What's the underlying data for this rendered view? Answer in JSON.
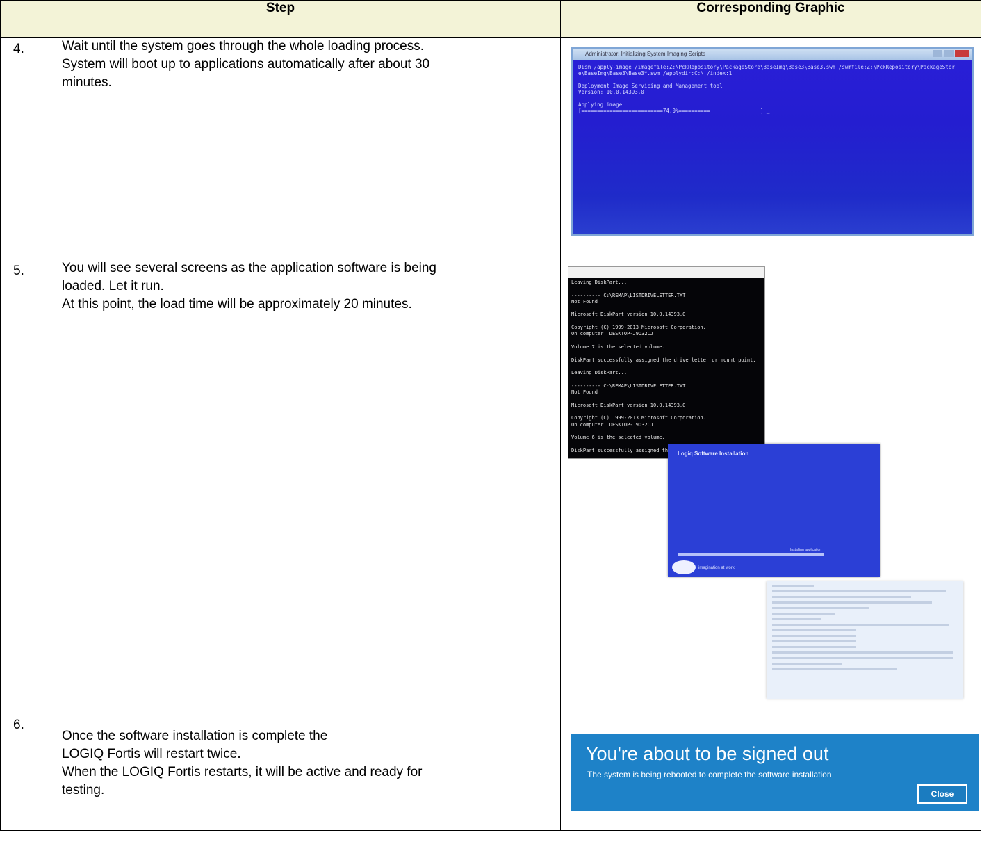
{
  "header": {
    "step": "Step",
    "graphic": "Corresponding Graphic"
  },
  "rows": [
    {
      "num": "4.",
      "lines": [
        "Wait until the system goes through the whole loading process.",
        "System will boot up to applications automatically after about 30",
        "minutes."
      ],
      "shot": {
        "title": "Administrator: Initializing System Imaging Scripts",
        "console": "Dism /apply-image /imagefile:Z:\\PckRepository\\PackageStore\\BaseImg\\Base3\\Base3.swm /swmfile:Z:\\PckRepository\\PackageStor\ne\\BaseImg\\Base3\\Base3*.swm /applydir:C:\\ /index:1\n\nDeployment Image Servicing and Management tool\nVersion: 10.0.14393.0\n\nApplying image\n[==========================74.0%==========                ] _"
      }
    },
    {
      "num": "5.",
      "lines": [
        "You will see several screens as the application software is being",
        "loaded. Let it run.",
        "At this point, the load time will be approximately 20 minutes."
      ],
      "shot": {
        "console": "Leaving DiskPart...\n\n---------- C:\\REMAP\\LISTDRIVELETTER.TXT\nNot Found\n\nMicrosoft DiskPart version 10.0.14393.0\n\nCopyright (C) 1999-2013 Microsoft Corporation.\nOn computer: DESKTOP-J9O32CJ\n\nVolume 7 is the selected volume.\n\nDiskPart successfully assigned the drive letter or mount point.\n\nLeaving DiskPart...\n\n---------- C:\\REMAP\\LISTDRIVELETTER.TXT\nNot Found\n\nMicrosoft DiskPart version 10.0.14393.0\n\nCopyright (C) 1999-2013 Microsoft Corporation.\nOn computer: DESKTOP-J9O32CJ\n\nVolume 6 is the selected volume.\n\nDiskPart successfully assigned the drive letter or mount point.\n\nLeaving DiskPart...",
        "install_title": "Logiq Software Installation",
        "progress_label": "Installing application",
        "tagline": "imagination at work"
      }
    },
    {
      "num": "6.",
      "lines": [
        "Once the software installation is complete the",
        "LOGIQ Fortis will restart twice.",
        "When the LOGIQ Fortis restarts, it will be active and ready for",
        "testing."
      ],
      "shot": {
        "heading": "You're about to be signed out",
        "message": "The system is being rebooted to complete the software installation",
        "close": "Close"
      }
    }
  ]
}
